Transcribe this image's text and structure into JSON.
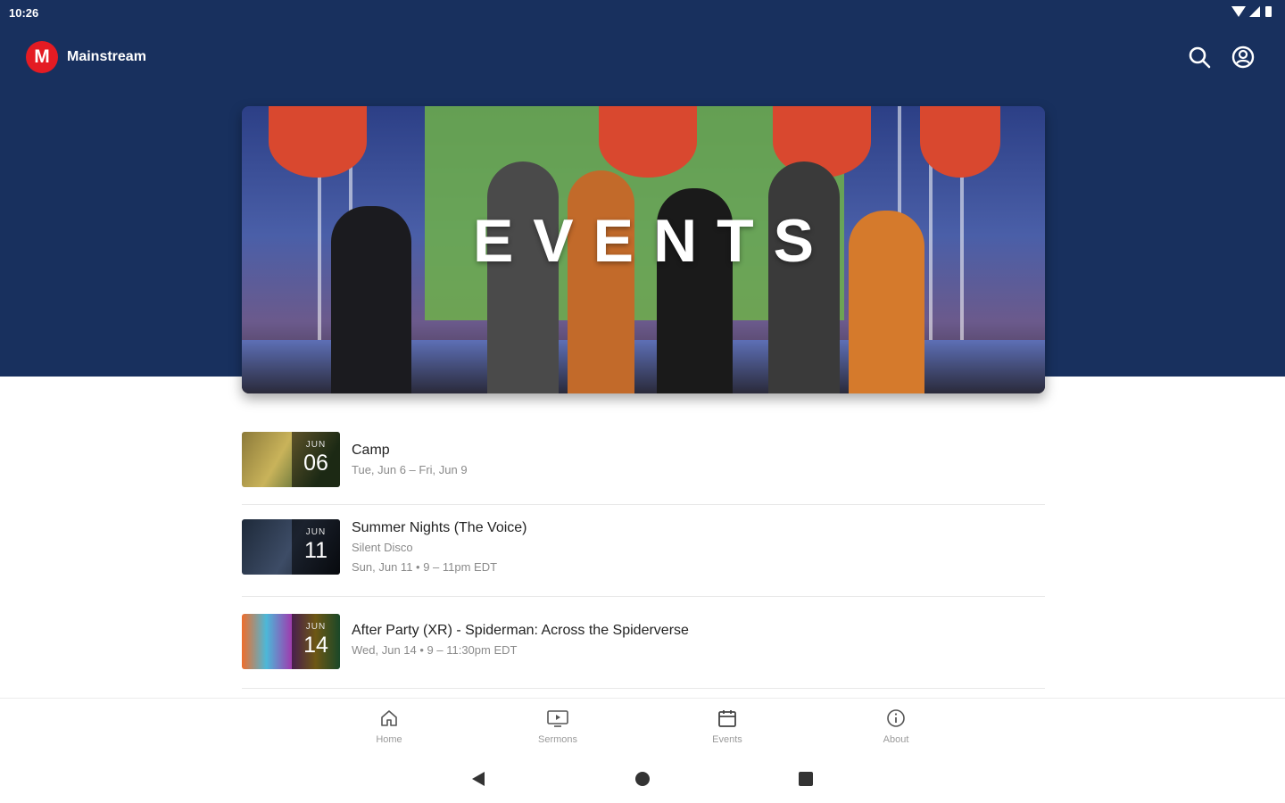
{
  "status_bar": {
    "time": "10:26"
  },
  "app_bar": {
    "brand": "Mainstream",
    "logo_letter": "M"
  },
  "hero": {
    "title": "EVENTS"
  },
  "events": [
    {
      "month": "JUN",
      "day": "06",
      "title": "Camp",
      "lines": [
        "Tue, Jun 6 – Fri, Jun 9"
      ]
    },
    {
      "month": "JUN",
      "day": "11",
      "title": "Summer Nights (The Voice)",
      "lines": [
        "Silent Disco",
        "Sun, Jun 11 • 9 – 11pm EDT"
      ]
    },
    {
      "month": "JUN",
      "day": "14",
      "title": "After Party (XR) - Spiderman: Across the Spiderverse",
      "lines": [
        "Wed, Jun 14 • 9 – 11:30pm EDT"
      ]
    }
  ],
  "bottom_nav": {
    "items": [
      {
        "label": "Home",
        "icon": "home-icon"
      },
      {
        "label": "Sermons",
        "icon": "tv-icon"
      },
      {
        "label": "Events",
        "icon": "calendar-icon"
      },
      {
        "label": "About",
        "icon": "info-icon"
      }
    ]
  },
  "colors": {
    "header_bg": "#18305e",
    "brand_red": "#e41b23",
    "muted_text": "#8a8a8a"
  }
}
